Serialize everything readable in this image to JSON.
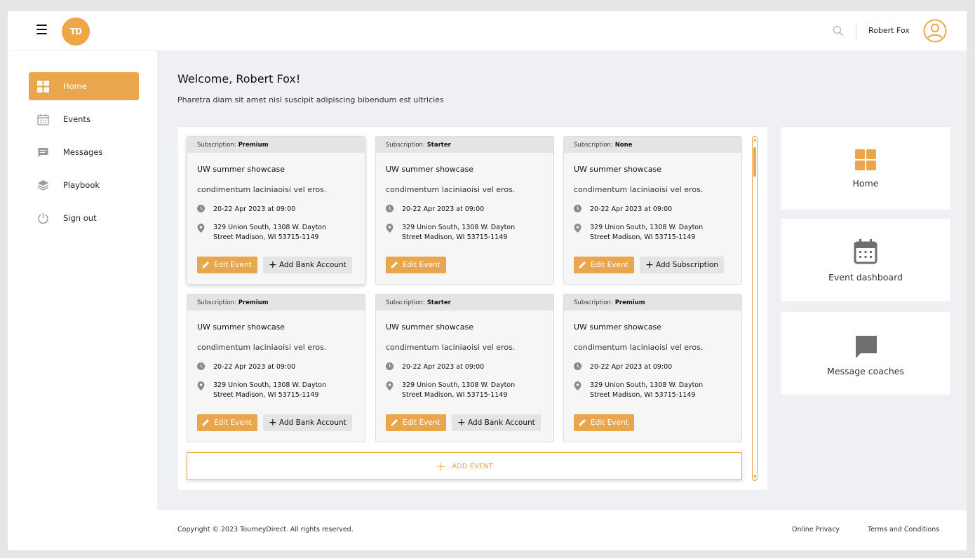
{
  "header": {
    "logo_text": "TD",
    "user_name": "Robert Fox"
  },
  "sidebar": {
    "items": [
      {
        "label": "Home",
        "icon": "grid-icon"
      },
      {
        "label": "Events",
        "icon": "calendar-icon"
      },
      {
        "label": "Messages",
        "icon": "message-icon"
      },
      {
        "label": "Playbook",
        "icon": "layers-icon"
      },
      {
        "label": "Sign out",
        "icon": "power-icon"
      }
    ]
  },
  "main": {
    "welcome": "Welcome, Robert Fox!",
    "subtitle": "Pharetra diam sit amet nisl suscipit adipiscing bibendum est ultricies",
    "events": [
      {
        "sub_label": "Subscription:",
        "sub_value": "Premium",
        "title": "UW summer showcase",
        "desc": "condimentum laciniaoisi vel eros.",
        "date": "20-22 Apr 2023 at 09:00",
        "addr1": "329 Union South, 1308 W. Dayton",
        "addr2": "Street Madison, WI 53715-1149",
        "edit": "Edit Event",
        "secondary": "Add Bank Account"
      },
      {
        "sub_label": "Subscription:",
        "sub_value": "Starter",
        "title": "UW summer showcase",
        "desc": "condimentum laciniaoisi vel eros.",
        "date": "20-22 Apr 2023 at 09:00",
        "addr1": "329 Union South, 1308 W. Dayton",
        "addr2": "Street Madison, WI 53715-1149",
        "edit": "Edit Event",
        "secondary": ""
      },
      {
        "sub_label": "Subscription:",
        "sub_value": "None",
        "title": "UW summer showcase",
        "desc": "condimentum laciniaoisi vel eros.",
        "date": "20-22 Apr 2023 at 09:00",
        "addr1": "329 Union South, 1308 W. Dayton",
        "addr2": "Street Madison, WI 53715-1149",
        "edit": "Edit Event",
        "secondary": "Add Subscription"
      },
      {
        "sub_label": "Subscription:",
        "sub_value": "Premium",
        "title": "UW summer showcase",
        "desc": "condimentum laciniaoisi vel eros.",
        "date": "20-22 Apr 2023 at 09:00",
        "addr1": "329 Union South, 1308 W. Dayton",
        "addr2": "Street Madison, WI 53715-1149",
        "edit": "Edit Event",
        "secondary": "Add Bank Account"
      },
      {
        "sub_label": "Subscription:",
        "sub_value": "Starter",
        "title": "UW summer showcase",
        "desc": "condimentum laciniaoisi vel eros.",
        "date": "20-22 Apr 2023 at 09:00",
        "addr1": "329 Union South, 1308 W. Dayton",
        "addr2": "Street Madison, WI 53715-1149",
        "edit": "Edit Event",
        "secondary": "Add Bank Account"
      },
      {
        "sub_label": "Subscription:",
        "sub_value": "Premium",
        "title": "UW summer showcase",
        "desc": "condimentum laciniaoisi vel eros.",
        "date": "20-22 Apr 2023 at 09:00",
        "addr1": "329 Union South, 1308 W. Dayton",
        "addr2": "Street Madison, WI 53715-1149",
        "edit": "Edit Event",
        "secondary": ""
      }
    ],
    "add_event": "ADD EVENT"
  },
  "shortcuts": [
    {
      "label": "Home",
      "icon": "grid-icon"
    },
    {
      "label": "Event dashboard",
      "icon": "calendar-icon"
    },
    {
      "label": "Message coaches",
      "icon": "chat-icon"
    }
  ],
  "footer": {
    "copyright": "Copyright © 2023 TourneyDirect. All rights reserved.",
    "privacy": "Online Privacy",
    "terms": "Terms and Conditions"
  },
  "colors": {
    "accent": "#e9a64c",
    "background": "#eff0f4",
    "icon_gray": "#8a8a8a"
  }
}
